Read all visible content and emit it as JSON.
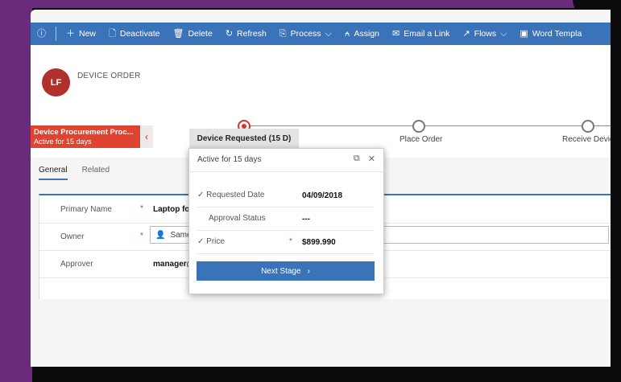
{
  "commandbar": {
    "items": [
      {
        "label": "New",
        "icon": "plus-icon"
      },
      {
        "label": "Deactivate",
        "icon": "deactivate-icon"
      },
      {
        "label": "Delete",
        "icon": "trash-icon"
      },
      {
        "label": "Refresh",
        "icon": "refresh-icon"
      },
      {
        "label": "Process",
        "icon": "process-icon"
      },
      {
        "label": "Assign",
        "icon": "assign-icon"
      },
      {
        "label": "Email a Link",
        "icon": "email-link-icon"
      },
      {
        "label": "Flows",
        "icon": "flows-icon"
      },
      {
        "label": "Word Templa",
        "icon": "word-template-icon"
      }
    ]
  },
  "record": {
    "avatar_initials": "LF",
    "title": "DEVICE ORDER"
  },
  "bpf": {
    "active_name": "Device Procurement Proc...",
    "active_status": "Active for 15 days",
    "stages": [
      {
        "label": "Device Requested  (15 D)",
        "state": "active"
      },
      {
        "label": "Place Order",
        "state": "inactive"
      },
      {
        "label": "Receive Devic",
        "state": "inactive"
      }
    ]
  },
  "tabs": {
    "general": "General",
    "related": "Related"
  },
  "form": {
    "primary_name": {
      "label": "Primary Name",
      "value": "Laptop for"
    },
    "owner": {
      "label": "Owner",
      "value": "Samee"
    },
    "approver": {
      "label": "Approver",
      "value": "manager@"
    }
  },
  "flyout": {
    "header": "Active for 15 days",
    "requested_date": {
      "label": "Requested Date",
      "value": "04/09/2018",
      "check": "✓"
    },
    "approval_status": {
      "label": "Approval Status",
      "value": "---"
    },
    "price": {
      "label": "Price",
      "value": "$899.990",
      "check": "✓"
    },
    "next_stage": "Next Stage"
  },
  "colors": {
    "command_bar": "#3b73b9",
    "active_stage": "#e0432f",
    "frame": "#6a2b7c"
  }
}
